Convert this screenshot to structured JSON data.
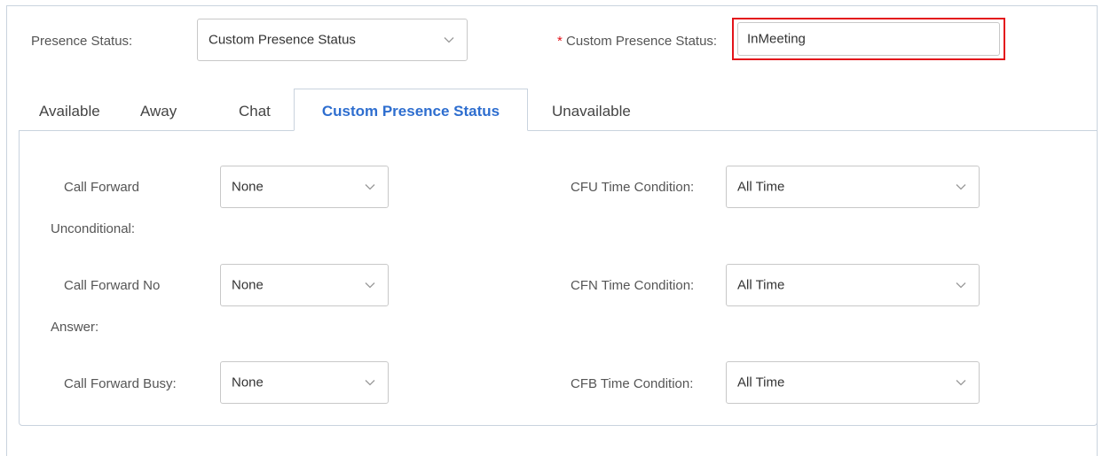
{
  "header": {
    "presence_status_label": "Presence Status:",
    "presence_status_value": "Custom Presence Status",
    "custom_presence_required_mark": "*",
    "custom_presence_label": "Custom Presence Status:",
    "custom_presence_value": "InMeeting"
  },
  "tabs": [
    {
      "label": "Available",
      "active": false
    },
    {
      "label": "Away",
      "active": false
    },
    {
      "label": "Chat",
      "active": false
    },
    {
      "label": "Custom Presence Status",
      "active": true
    },
    {
      "label": "Unavailable",
      "active": false
    }
  ],
  "form": {
    "cfu": {
      "label_line1": "Call Forward",
      "label_line2": "Unconditional:",
      "value": "None",
      "time_label": "CFU Time Condition:",
      "time_value": "All Time"
    },
    "cfn": {
      "label_line1": "Call Forward No",
      "label_line2": "Answer:",
      "value": "None",
      "time_label": "CFN Time Condition:",
      "time_value": "All Time"
    },
    "cfb": {
      "label": "Call Forward Busy:",
      "value": "None",
      "time_label": "CFB Time Condition:",
      "time_value": "All Time"
    }
  },
  "icons": {
    "dropdown": "chevron-down-icon"
  },
  "colors": {
    "active_tab": "#2e6ecf",
    "highlight_border": "#e3141b",
    "required_mark": "#e3141b",
    "border": "#c9d3de"
  }
}
